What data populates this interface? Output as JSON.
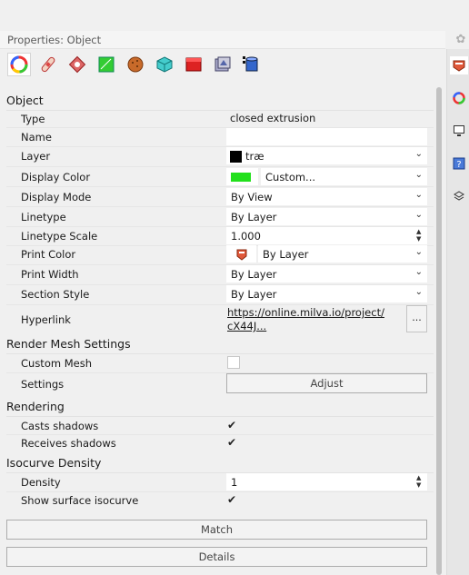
{
  "panel": {
    "title": "Properties: Object"
  },
  "toolbar": {
    "icons": [
      "color-wheel-icon",
      "bandage-icon",
      "decal-icon",
      "texture-icon",
      "material-sphere-icon",
      "light-box-icon",
      "red-box-icon",
      "frame-icon",
      "database-icon"
    ]
  },
  "object": {
    "heading": "Object",
    "type_label": "Type",
    "type_value": "closed extrusion",
    "name_label": "Name",
    "name_value": "",
    "layer_label": "Layer",
    "layer_value": "træ",
    "display_color_label": "Display Color",
    "display_color_value": "Custom...",
    "display_mode_label": "Display Mode",
    "display_mode_value": "By View",
    "linetype_label": "Linetype",
    "linetype_value": "By Layer",
    "linetype_scale_label": "Linetype Scale",
    "linetype_scale_value": "1.000",
    "print_color_label": "Print Color",
    "print_color_value": "By Layer",
    "print_width_label": "Print Width",
    "print_width_value": "By Layer",
    "section_style_label": "Section Style",
    "section_style_value": "By Layer",
    "hyperlink_label": "Hyperlink",
    "hyperlink_line1": "https://online.milva.io/project/",
    "hyperlink_line2": "cX44J...",
    "hyperlink_button": "..."
  },
  "render_mesh": {
    "heading": "Render Mesh Settings",
    "custom_mesh_label": "Custom Mesh",
    "settings_label": "Settings",
    "adjust_button": "Adjust"
  },
  "rendering": {
    "heading": "Rendering",
    "casts_shadows_label": "Casts shadows",
    "receives_shadows_label": "Receives shadows"
  },
  "isocurve": {
    "heading": "Isocurve Density",
    "density_label": "Density",
    "density_value": "1",
    "show_surface_label": "Show surface isocurve"
  },
  "buttons": {
    "match": "Match",
    "details": "Details"
  },
  "colors": {
    "display_color": "#22e01c",
    "layer_color": "#000000",
    "accent": "#2f6fdc"
  },
  "side_tabs": [
    "object-properties-tab-icon",
    "material-tab-icon",
    "display-tab-icon",
    "help-tab-icon",
    "layers-tab-icon"
  ]
}
